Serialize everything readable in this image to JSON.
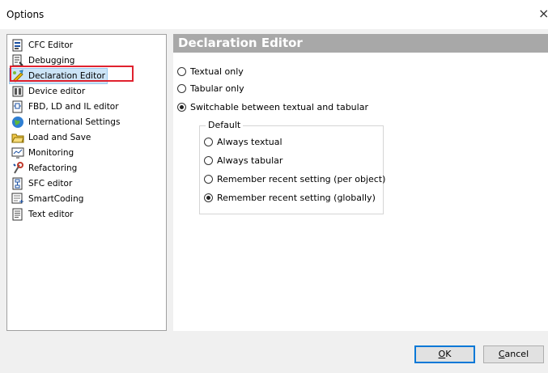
{
  "window": {
    "title": "Options",
    "close_glyph": "×"
  },
  "tree": {
    "items": [
      {
        "label": "CFC Editor",
        "icon": "cfc-editor-icon"
      },
      {
        "label": "Debugging",
        "icon": "debugging-icon"
      },
      {
        "label": "Declaration Editor",
        "icon": "declaration-editor-icon",
        "selected": true
      },
      {
        "label": "Device editor",
        "icon": "device-editor-icon"
      },
      {
        "label": "FBD, LD and IL editor",
        "icon": "fbd-editor-icon"
      },
      {
        "label": "International Settings",
        "icon": "globe-icon"
      },
      {
        "label": "Load and Save",
        "icon": "folder-icon"
      },
      {
        "label": "Monitoring",
        "icon": "monitoring-icon"
      },
      {
        "label": "Refactoring",
        "icon": "refactoring-icon"
      },
      {
        "label": "SFC editor",
        "icon": "sfc-editor-icon"
      },
      {
        "label": "SmartCoding",
        "icon": "smartcoding-icon"
      },
      {
        "label": "Text editor",
        "icon": "text-editor-icon"
      }
    ]
  },
  "panel": {
    "header": "Declaration Editor",
    "options": [
      {
        "label": "Textual only",
        "checked": false
      },
      {
        "label": "Tabular only",
        "checked": false
      },
      {
        "label": "Switchable between textual and tabular",
        "checked": true
      }
    ],
    "default_group": {
      "legend": "Default",
      "options": [
        {
          "label": "Always textual",
          "checked": false
        },
        {
          "label": "Always tabular",
          "checked": false
        },
        {
          "label": "Remember recent setting (per object)",
          "checked": false
        },
        {
          "label": "Remember recent setting (globally)",
          "checked": true
        }
      ]
    }
  },
  "buttons": {
    "ok": {
      "label": "OK",
      "mnemonic": "O",
      "rest": "K"
    },
    "cancel": {
      "label": "Cancel",
      "mnemonic": "C",
      "rest": "ancel"
    }
  },
  "colors": {
    "header_bg": "#a8a8a8",
    "selection_bg": "#cce4f7",
    "annotation_red": "#e0212e",
    "primary_button_border": "#0078d7"
  }
}
